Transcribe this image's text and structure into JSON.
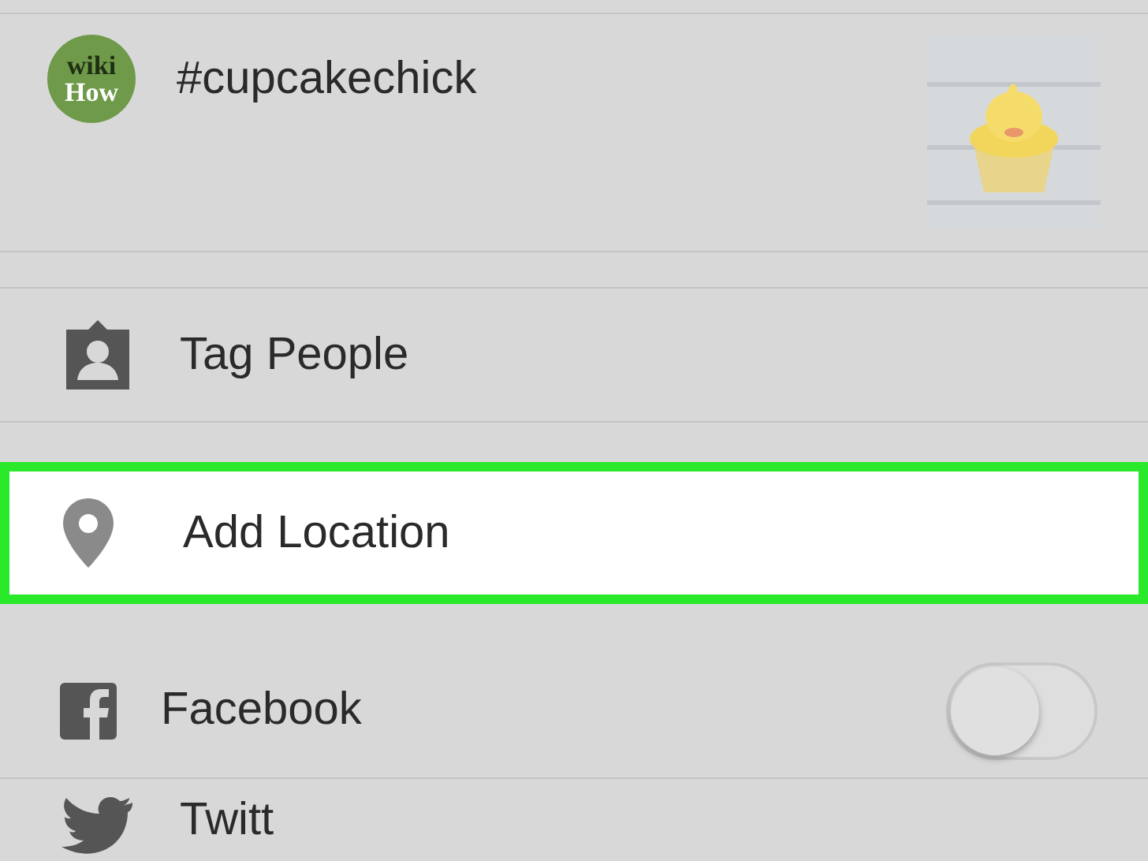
{
  "post": {
    "avatar": {
      "line_1": "wiki",
      "line_2": "How"
    },
    "caption": "#cupcakechick"
  },
  "options": [
    {
      "kind": "tag",
      "label": "Tag People",
      "selected": false
    },
    {
      "kind": "location",
      "label": "Add Location",
      "selected": true
    }
  ],
  "share": [
    {
      "kind": "facebook",
      "label": "Facebook",
      "on": false
    },
    {
      "kind": "twitter",
      "label": "Twitt"
    }
  ]
}
